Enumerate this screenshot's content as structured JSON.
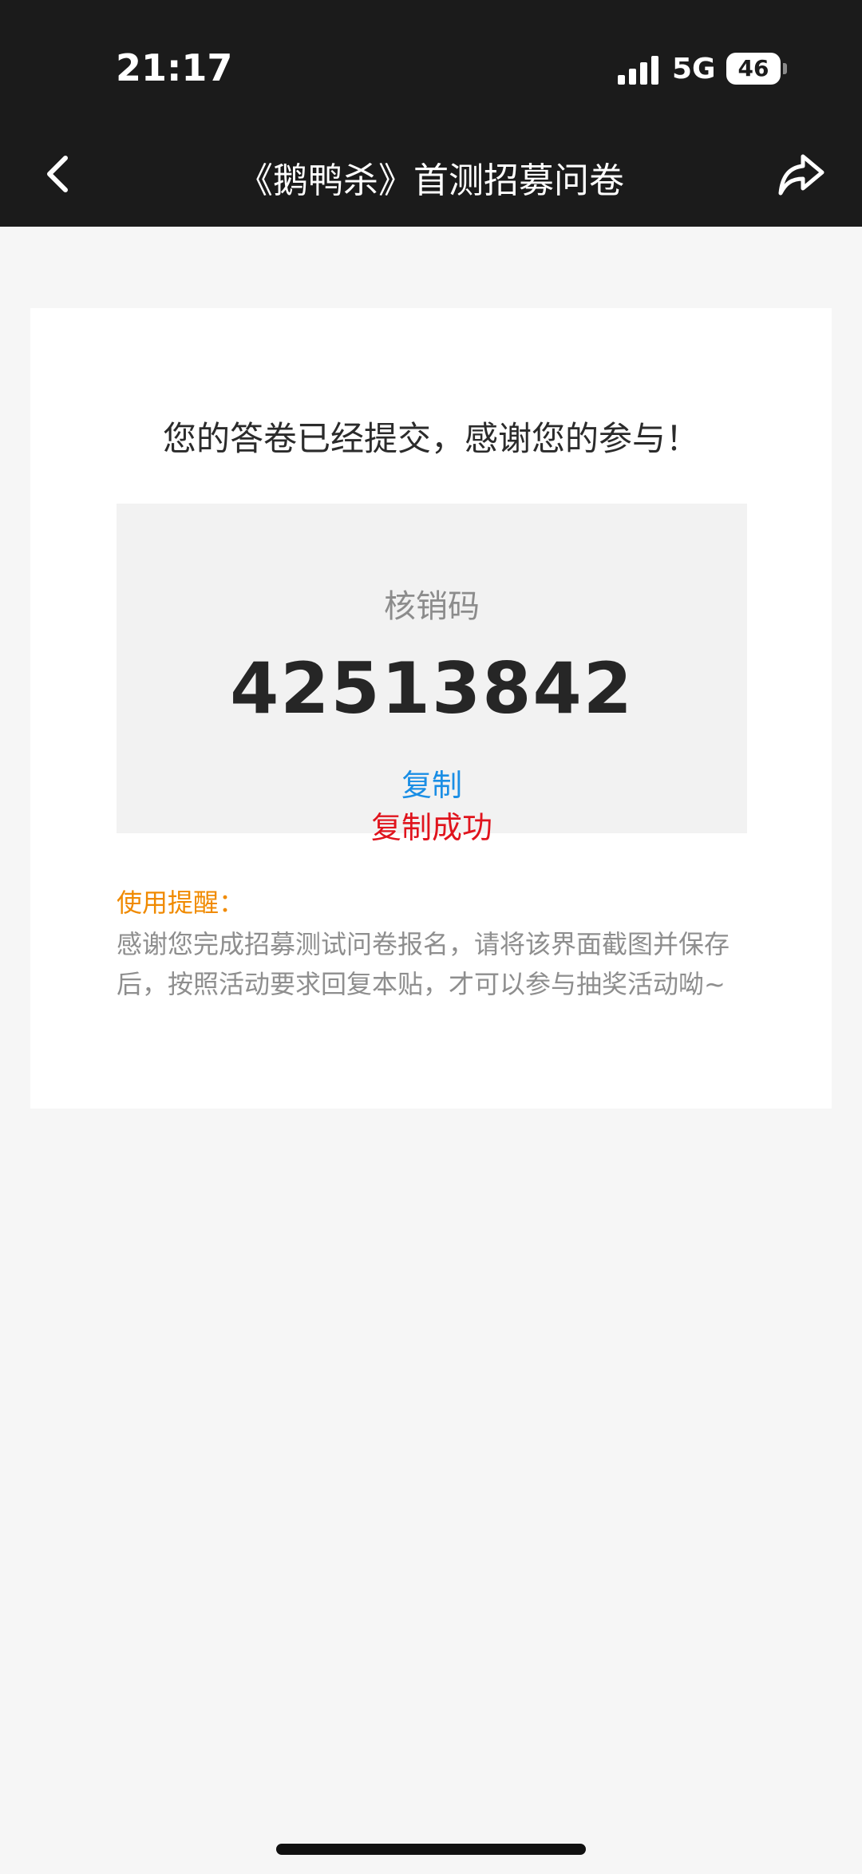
{
  "status_bar": {
    "time": "21:17",
    "network": "5G",
    "battery": "46"
  },
  "nav": {
    "title": "《鹅鸭杀》首测招募问卷",
    "back_icon": "chevron-left-icon",
    "share_icon": "share-arrow-icon"
  },
  "result": {
    "message": "您的答卷已经提交，感谢您的参与！",
    "code_label": "核销码",
    "code_value": "42513842",
    "copy_label": "复制",
    "copy_status": "复制成功"
  },
  "reminder": {
    "title": "使用提醒：",
    "text": "感谢您完成招募测试问卷报名，请将该界面截图并保存后，按照活动要求回复本贴，才可以参与抽奖活动呦~"
  },
  "colors": {
    "nav_background": "#1b1b1b",
    "page_background": "#f6f6f6",
    "copy_link": "#1a8ee5",
    "copy_success": "#e0141d",
    "reminder_title": "#f08a00"
  }
}
